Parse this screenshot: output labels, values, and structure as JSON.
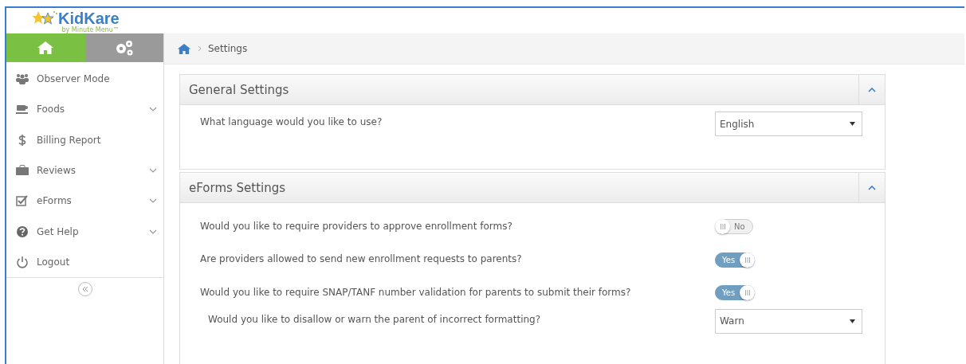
{
  "logo": {
    "name": "KidKare",
    "tagline": "by Minute Menu™"
  },
  "nav_tabs": [
    {
      "kind": "home",
      "selected": true
    },
    {
      "kind": "gears",
      "selected": false
    }
  ],
  "sidebar": {
    "items": [
      {
        "kind": "people",
        "label": "Observer Mode",
        "expandable": false
      },
      {
        "kind": "cup",
        "label": "Foods",
        "expandable": true
      },
      {
        "kind": "dollar",
        "label": "Billing Report",
        "expandable": false
      },
      {
        "kind": "briefcase",
        "label": "Reviews",
        "expandable": true
      },
      {
        "kind": "checkbox",
        "label": "eForms",
        "expandable": true
      },
      {
        "kind": "help",
        "label": "Get Help",
        "expandable": true
      },
      {
        "kind": "power",
        "label": "Logout",
        "expandable": false
      }
    ]
  },
  "breadcrumb": [
    "Settings"
  ],
  "panels": [
    {
      "title": "General Settings",
      "expanded": true,
      "rows": [
        {
          "kind": "select",
          "question": "What language would you like to use?",
          "value": "English",
          "indented": false
        }
      ]
    },
    {
      "title": "eForms Settings",
      "expanded": true,
      "rows": [
        {
          "kind": "toggle",
          "question": "Would you like to require providers to approve enrollment forms?",
          "on": false,
          "label": "No",
          "indented": false
        },
        {
          "kind": "toggle",
          "question": "Are providers allowed to send new enrollment requests to parents?",
          "on": true,
          "label": "Yes",
          "indented": false
        },
        {
          "kind": "toggle",
          "question": "Would you like to require SNAP/TANF number validation for parents to submit their forms?",
          "on": true,
          "label": "Yes",
          "indented": false
        },
        {
          "kind": "select",
          "question": "Would you like to disallow or warn the parent of incorrect formatting?",
          "value": "Warn",
          "indented": true
        }
      ]
    }
  ]
}
